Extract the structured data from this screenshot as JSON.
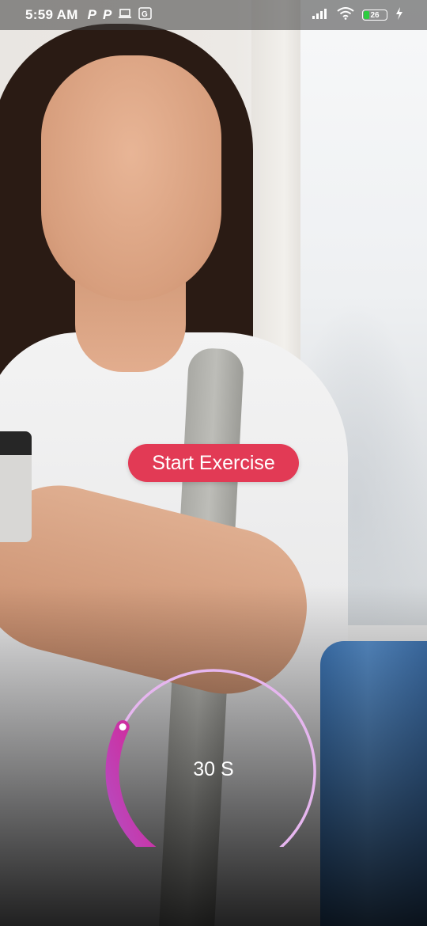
{
  "status_bar": {
    "time": "5:59 AM",
    "left_icons": [
      "p-icon",
      "p-icon",
      "laptop-icon",
      "translate-icon"
    ],
    "right_icons": [
      "signal-icon",
      "wifi-icon",
      "battery-icon",
      "charging-icon"
    ],
    "battery_level": "26",
    "battery_fraction": 0.26
  },
  "main": {
    "start_button_label": "Start Exercise",
    "start_button_color": "#e23a55"
  },
  "timer": {
    "label": "30 S",
    "progress_fraction": 0.28,
    "gradient_start": "#b44fc4",
    "gradient_end": "#d91f8f",
    "track_color": "#e6b6ef"
  }
}
